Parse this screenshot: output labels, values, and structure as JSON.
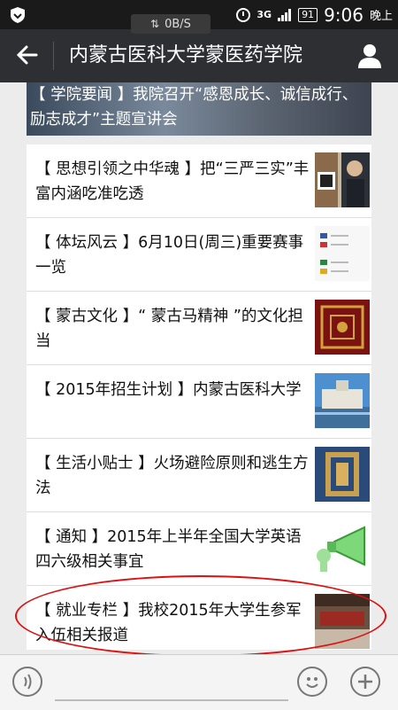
{
  "status_bar": {
    "net_speed": "0B/S",
    "signal": "3G",
    "battery": "91",
    "time": "9:06",
    "ampm": "晚上"
  },
  "header": {
    "title": "内蒙古医科大学蒙医药学院"
  },
  "articles": [
    {
      "label": "【 学院要闻 】我院召开“感恩成长、诚信成行、励志成才”主题宣讲会"
    },
    {
      "label": "【 思想引领之中华魂 】把“三严三实”丰富内涵吃准吃透"
    },
    {
      "label": "【 体坛风云 】6月10日(周三)重要赛事一览"
    },
    {
      "label": "【 蒙古文化 】“ 蒙古马精神 ”的文化担当"
    },
    {
      "label": "【 2015年招生计划 】内蒙古医科大学"
    },
    {
      "label": "【 生活小贴士 】火场避险原则和逃生方法"
    },
    {
      "label": "【 通知 】2015年上半年全国大学英语四六级相关事宜"
    },
    {
      "label": "【 就业专栏 】我校2015年大学生参军入伍相关报道"
    }
  ],
  "colors": {
    "title_bar": "#2d2f33",
    "status_bar": "#1a1a1a",
    "highlight_circle": "#dd1111"
  }
}
